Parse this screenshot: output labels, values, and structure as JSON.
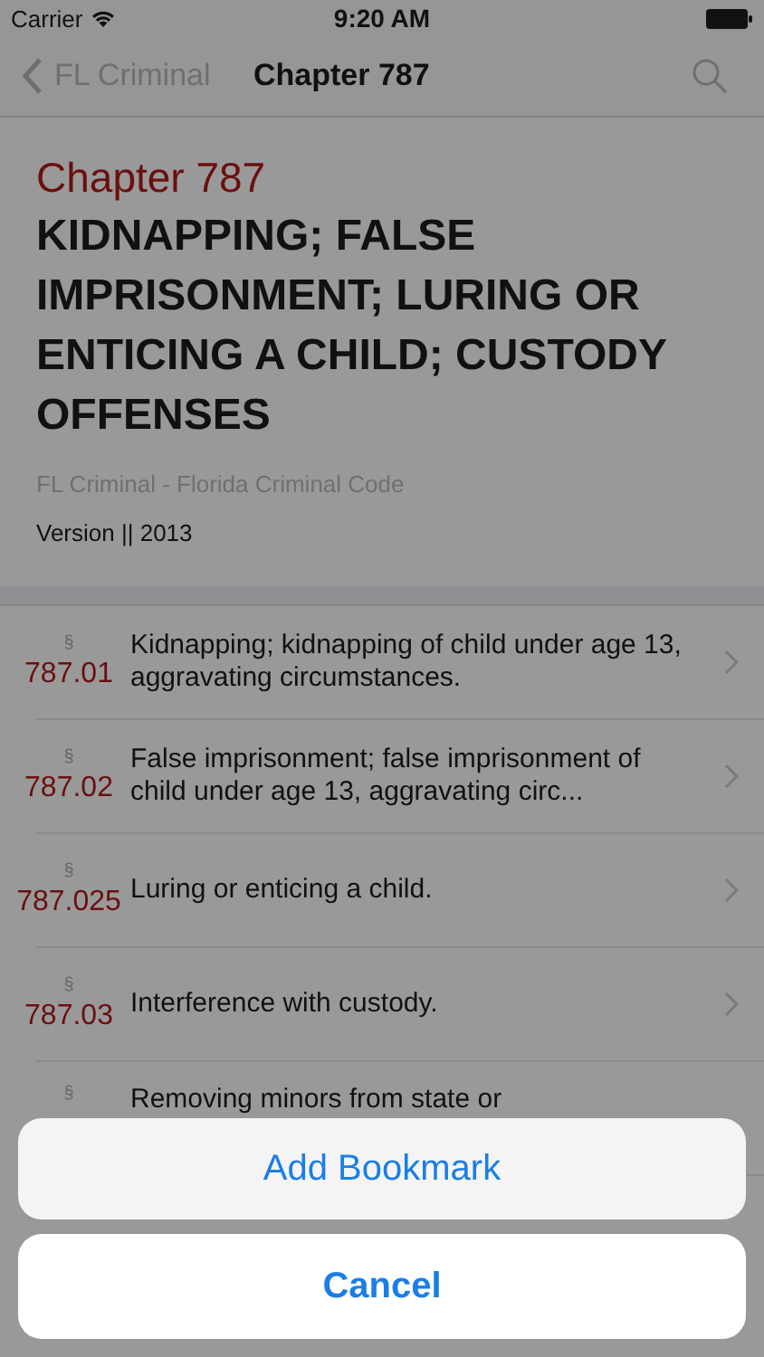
{
  "status_bar": {
    "carrier": "Carrier",
    "time": "9:20 AM"
  },
  "nav": {
    "back": "FL Criminal",
    "title": "Chapter 787"
  },
  "header": {
    "chapter": "Chapter 787",
    "title": "KIDNAPPING; FALSE IMPRISONMENT; LURING OR ENTICING A CHILD; CUSTODY OFFENSES",
    "source": "FL Criminal - Florida Criminal Code",
    "version": "Version || 2013"
  },
  "sections": [
    {
      "symbol": "§",
      "number": "787.01",
      "text": "Kidnapping; kidnapping of child under age 13, aggravating circumstances."
    },
    {
      "symbol": "§",
      "number": "787.02",
      "text": "False imprisonment; false imprisonment of child under age 13, aggravating circ..."
    },
    {
      "symbol": "§",
      "number": "787.025",
      "text": "Luring or enticing a child."
    },
    {
      "symbol": "§",
      "number": "787.03",
      "text": "Interference with custody."
    },
    {
      "symbol": "§",
      "text": "Removing minors from state or"
    }
  ],
  "action_sheet": {
    "actions": [
      "Add Bookmark"
    ],
    "cancel": "Cancel"
  }
}
